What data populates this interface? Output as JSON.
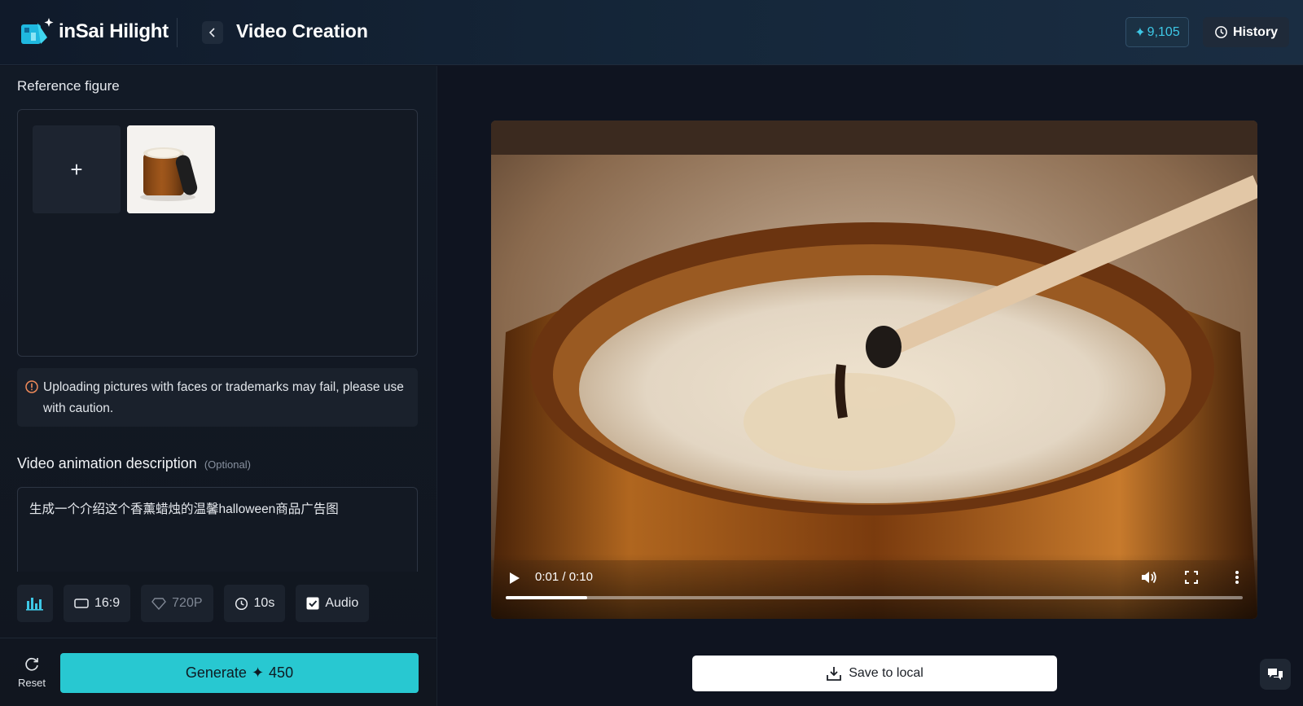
{
  "header": {
    "logo_text": "inSai Hilight",
    "page_title": "Video Creation",
    "credits": "9,105",
    "history_label": "History"
  },
  "left": {
    "reference_label": "Reference figure",
    "warning_text": "Uploading pictures with faces or trademarks may fail, please use with caution.",
    "description_label": "Video animation description",
    "description_optional": "(Optional)",
    "description_value": "生成一个介绍这个香薰蜡烛的温馨halloween商品广告图",
    "options": {
      "aspect_ratio": "16:9",
      "resolution": "720P",
      "duration": "10s",
      "audio": "Audio",
      "audio_checked": true
    },
    "reset_label": "Reset",
    "generate_label": "Generate",
    "generate_cost": "450"
  },
  "video": {
    "current_time": "0:01",
    "total_time": "0:10",
    "progress": 0.11
  },
  "save_label": "Save to local",
  "colors": {
    "accent": "#28c8d1",
    "credit_text": "#3ec8e6",
    "warning": "#f08a5a"
  }
}
